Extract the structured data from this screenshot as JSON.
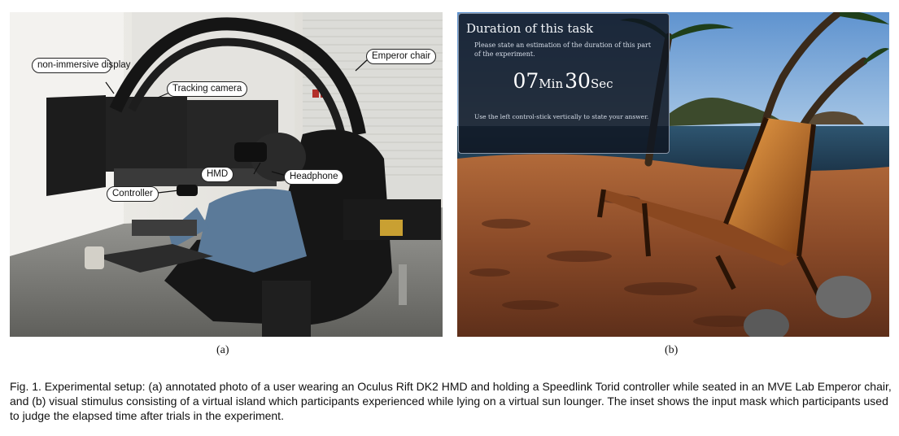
{
  "panel_a": {
    "callouts": {
      "display": "non-immersive display",
      "emperor": "Emperor chair",
      "camera": "Tracking camera",
      "hmd": "HMD",
      "headphone": "Headphone",
      "controller": "Controller"
    },
    "label": "(a)"
  },
  "panel_b": {
    "inset": {
      "title": "Duration of this task",
      "prompt": "Please state an estimation of the duration of this part of the experiment.",
      "minutes": "07",
      "min_unit": "Min",
      "seconds": "30",
      "sec_unit": "Sec",
      "hint": "Use the left control-stick vertically to state your answer."
    },
    "label": "(b)"
  },
  "caption": "Fig. 1. Experimental setup: (a) annotated photo of a user wearing an Oculus Rift DK2 HMD and holding a Speedlink Torid controller while seated in an MVE Lab Emperor chair, and (b) visual stimulus consisting of a virtual island which participants experienced while lying on a virtual sun lounger. The inset shows the input mask which participants used to judge the elapsed time after trials in the experiment."
}
